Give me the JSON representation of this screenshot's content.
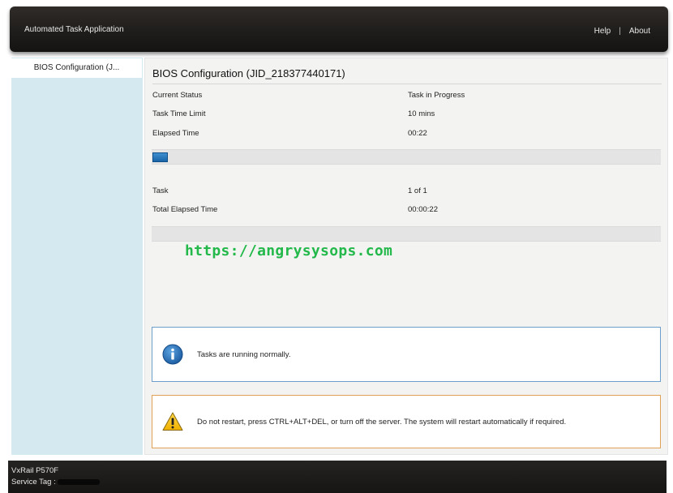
{
  "header": {
    "app_title": "Automated Task Application",
    "help_label": "Help",
    "separator": "|",
    "about_label": "About"
  },
  "sidebar": {
    "items": [
      {
        "label": "BIOS Configuration (J..."
      }
    ]
  },
  "main": {
    "title": "BIOS Configuration (JID_218377440171)",
    "current_status_label": "Current Status",
    "current_status_value": "Task in Progress",
    "task_time_limit_label": "Task Time Limit",
    "task_time_limit_value": "10 mins",
    "elapsed_time_label": "Elapsed Time",
    "elapsed_time_value": "00:22",
    "task_progress": 0.03,
    "task_label": "Task",
    "task_value": "1 of 1",
    "total_elapsed_label": "Total Elapsed Time",
    "total_elapsed_value": "00:00:22",
    "overall_progress": 0.0
  },
  "alerts": {
    "info_message": "Tasks are running normally.",
    "warning_message": "Do not restart, press CTRL+ALT+DEL, or turn off the server.  The system will restart automatically if required."
  },
  "watermark": "https://angrysysops.com",
  "footer": {
    "model": "VxRail P570F",
    "service_tag_label": "Service Tag :"
  },
  "icons": {
    "info": "info-icon",
    "warning": "warning-icon"
  },
  "colors": {
    "progress_fill": "#1f6fb5",
    "info_border": "#6d9fcc",
    "warning_border": "#e0a055",
    "sidebar_bg": "#d4e9f0",
    "watermark": "#22b84a"
  }
}
